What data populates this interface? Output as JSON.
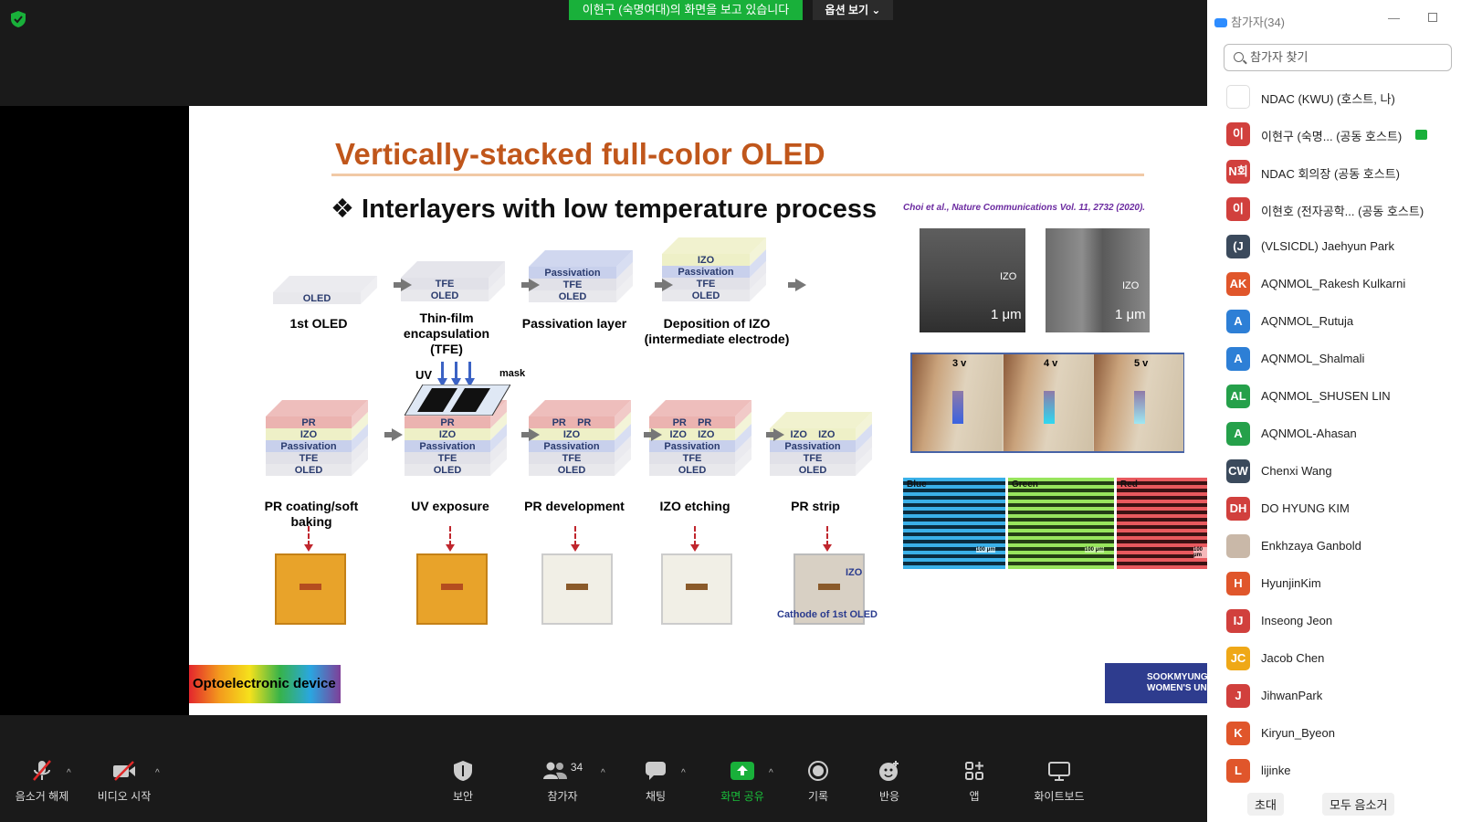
{
  "top": {
    "banner": "이현구 (숙명여대)의 화면을 보고 있습니다",
    "view_options": "옵션 보기"
  },
  "slide": {
    "title": "Vertically-stacked full-color OLED",
    "subtitle": "❖ Interlayers with low temperature process",
    "citation": "Choi et al., Nature Communications Vol. 11, 2732 (2020).",
    "row1": [
      {
        "layers": [
          "OLED"
        ],
        "label": "1st OLED"
      },
      {
        "layers": [
          "TFE",
          "OLED"
        ],
        "label": "Thin-film encapsulation (TFE)"
      },
      {
        "layers": [
          "Passivation",
          "TFE",
          "OLED"
        ],
        "label": "Passivation layer"
      },
      {
        "layers": [
          "IZO",
          "Passivation",
          "TFE",
          "OLED"
        ],
        "label": "Deposition of IZO (intermediate electrode)"
      }
    ],
    "uv_label": "UV",
    "mask_label": "mask",
    "row2": [
      {
        "layers": [
          "PR",
          "IZO",
          "Passivation",
          "TFE",
          "OLED"
        ],
        "label": "PR coating/soft baking"
      },
      {
        "layers": [
          "PR",
          "IZO",
          "Passivation",
          "TFE",
          "OLED"
        ],
        "label": "UV exposure"
      },
      {
        "layers": [
          "PR    PR",
          "IZO",
          "Passivation",
          "TFE",
          "OLED"
        ],
        "label": "PR development"
      },
      {
        "layers": [
          "PR    PR",
          "IZO    IZO",
          "Passivation",
          "TFE",
          "OLED"
        ],
        "label": "IZO etching"
      },
      {
        "layers": [
          "IZO    IZO",
          "Passivation",
          "TFE",
          "OLED"
        ],
        "label": "PR strip"
      }
    ],
    "photo_izo": "IZO",
    "photo_cathode": "Cathode of 1st OLED",
    "sem_izo": "IZO",
    "sem_scale": "1 μm",
    "voltages": [
      "3 v",
      "4 v",
      "5 v"
    ],
    "stripes": [
      "Blue",
      "Green",
      "Red"
    ],
    "stripe_scale": "100 μm",
    "lab_logo": "Optoelectronic device Lab.",
    "univ_logo_1": "SOOKMYUNG",
    "univ_logo_2": "WOMEN'S UNI"
  },
  "toolbar": {
    "mute": "음소거 해제",
    "video": "비디오 시작",
    "security": "보안",
    "participants": "참가자",
    "participants_count": "34",
    "chat": "채팅",
    "share": "화면 공유",
    "record": "기록",
    "reactions": "반응",
    "apps": "앱",
    "whiteboard": "화이트보드"
  },
  "panel": {
    "title": "참가자(34)",
    "search_placeholder": "참가자 찾기",
    "participants": [
      {
        "initials": "",
        "name": "NDAC (KWU) (호스트, 나)",
        "color": "#ffffff"
      },
      {
        "initials": "이",
        "name": "이현구 (숙명...  (공동 호스트)",
        "color": "#d1403d"
      },
      {
        "initials": "N회",
        "name": "NDAC 회의장 (공동 호스트)",
        "color": "#d1403d"
      },
      {
        "initials": "이",
        "name": "이현호 (전자공학...  (공동 호스트)",
        "color": "#d1403d"
      },
      {
        "initials": "(J",
        "name": "(VLSICDL) Jaehyun Park",
        "color": "#3b4a5c"
      },
      {
        "initials": "AK",
        "name": "AQNMOL_Rakesh Kulkarni",
        "color": "#e0562b"
      },
      {
        "initials": "A",
        "name": "AQNMOL_Rutuja",
        "color": "#2d7fd6"
      },
      {
        "initials": "A",
        "name": "AQNMOL_Shalmali",
        "color": "#2d7fd6"
      },
      {
        "initials": "AL",
        "name": "AQNMOL_SHUSEN LIN",
        "color": "#25a04a"
      },
      {
        "initials": "A",
        "name": "AQNMOL-Ahasan",
        "color": "#25a04a"
      },
      {
        "initials": "CW",
        "name": "Chenxi Wang",
        "color": "#3b4a5c"
      },
      {
        "initials": "DH",
        "name": "DO HYUNG KIM",
        "color": "#d1403d"
      },
      {
        "initials": "",
        "name": "Enkhzaya Ganbold",
        "color": "#c9b8a8"
      },
      {
        "initials": "H",
        "name": "HyunjinKim",
        "color": "#e0562b"
      },
      {
        "initials": "IJ",
        "name": "Inseong Jeon",
        "color": "#d1403d"
      },
      {
        "initials": "JC",
        "name": "Jacob Chen",
        "color": "#efa817"
      },
      {
        "initials": "J",
        "name": "JihwanPark",
        "color": "#d1403d"
      },
      {
        "initials": "K",
        "name": "Kiryun_Byeon",
        "color": "#e0562b"
      },
      {
        "initials": "L",
        "name": "lijinke",
        "color": "#e0562b"
      }
    ],
    "invite": "초대",
    "mute_all": "모두 음소거"
  },
  "colors": {
    "banner": "#19b03a",
    "title": "#c0561b",
    "accent": "#2d8cff"
  }
}
